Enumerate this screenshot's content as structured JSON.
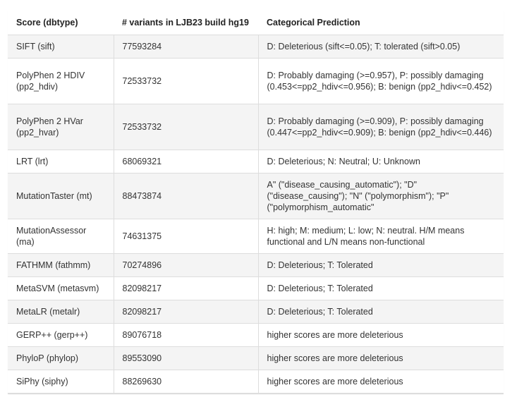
{
  "table": {
    "headers": [
      "Score (dbtype)",
      "# variants in LJB23 build hg19",
      "Categorical Prediction"
    ],
    "rows": [
      {
        "score": "SIFT (sift)",
        "variants": "77593284",
        "prediction": "D: Deleterious (sift<=0.05); T: tolerated (sift>0.05)"
      },
      {
        "score": "PolyPhen 2 HDIV (pp2_hdiv)",
        "variants": "72533732",
        "prediction": "D: Probably damaging (>=0.957), P: possibly damaging (0.453<=pp2_hdiv<=0.956); B: benign (pp2_hdiv<=0.452)"
      },
      {
        "score": "PolyPhen 2 HVar (pp2_hvar)",
        "variants": "72533732",
        "prediction": "D: Probably damaging (>=0.909), P: possibly damaging (0.447<=pp2_hdiv<=0.909); B: benign (pp2_hdiv<=0.446)"
      },
      {
        "score": "LRT (lrt)",
        "variants": "68069321",
        "prediction": "D: Deleterious; N: Neutral; U: Unknown"
      },
      {
        "score": "MutationTaster (mt)",
        "variants": "88473874",
        "prediction": "A\" (\"disease_causing_automatic\"); \"D\" (\"disease_causing\"); \"N\" (\"polymorphism\"); \"P\" (\"polymorphism_automatic\""
      },
      {
        "score": "MutationAssessor (ma)",
        "variants": "74631375",
        "prediction": "H: high; M: medium; L: low; N: neutral. H/M means functional and L/N means non-functional"
      },
      {
        "score": "FATHMM (fathmm)",
        "variants": "70274896",
        "prediction": "D: Deleterious; T: Tolerated"
      },
      {
        "score": "MetaSVM (metasvm)",
        "variants": "82098217",
        "prediction": "D: Deleterious; T: Tolerated"
      },
      {
        "score": "MetaLR (metalr)",
        "variants": "82098217",
        "prediction": "D: Deleterious; T: Tolerated"
      },
      {
        "score": "GERP++ (gerp++)",
        "variants": "89076718",
        "prediction": "higher scores are more deleterious"
      },
      {
        "score": "PhyloP (phylop)",
        "variants": "89553090",
        "prediction": "higher scores are more deleterious"
      },
      {
        "score": "SiPhy (siphy)",
        "variants": "88269630",
        "prediction": "higher scores are more deleterious"
      }
    ]
  }
}
